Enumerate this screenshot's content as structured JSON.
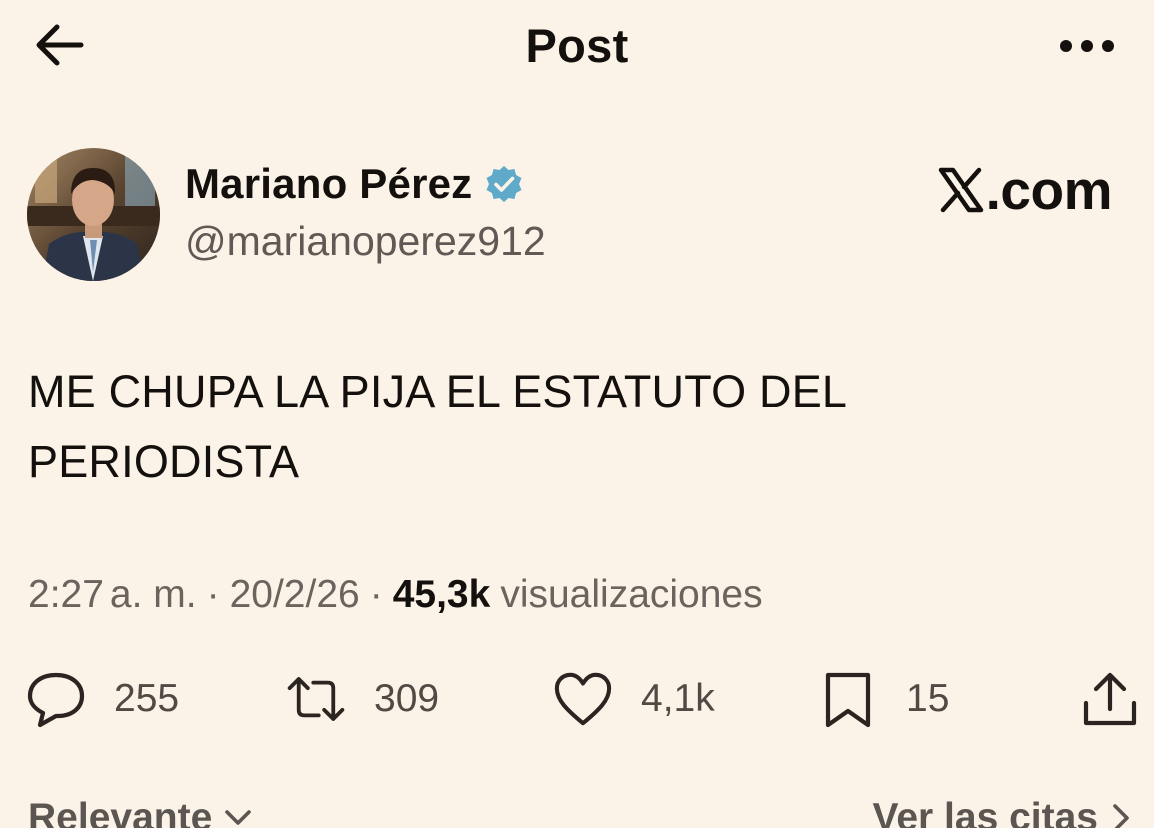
{
  "header": {
    "title": "Post"
  },
  "author": {
    "name": "Mariano Pérez",
    "handle": "@marianoperez912",
    "verified_color": "#5fa9c9"
  },
  "brand": {
    "domain_text": ".com"
  },
  "post": {
    "line1": "ME CHUPA LA PIJA EL ESTATUTO DEL",
    "line2": "PERIODISTA"
  },
  "meta": {
    "time": "2:27",
    "ampm": "a. m.",
    "sep1": "·",
    "date": "20/2/26",
    "sep2": "·",
    "views": "45,3k",
    "views_label": "visualizaciones"
  },
  "actions": {
    "replies": "255",
    "reposts": "309",
    "likes": "4,1k",
    "bookmarks": "15"
  },
  "footer": {
    "sort_label": "Relevante",
    "quotes_label": "Ver las citas"
  },
  "icons": [
    "back-arrow-icon",
    "more-icon",
    "verified-icon",
    "x-logo-icon",
    "reply-icon",
    "repost-icon",
    "like-icon",
    "bookmark-icon",
    "share-icon",
    "chevron-down-icon",
    "chevron-right-icon"
  ]
}
